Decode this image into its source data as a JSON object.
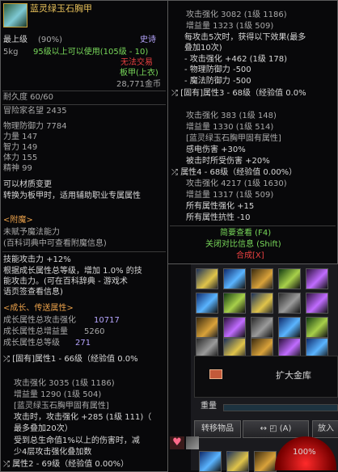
{
  "left": {
    "item_name": "蓝灵绿玉石胸甲",
    "grade": "最上级",
    "grade_pct": "(90%)",
    "rarity": "史诗",
    "weight": "5kg",
    "level_req": "95级以上可以使用(105级 - 10)",
    "trade": "无法交易",
    "slot_type": "板甲(上衣)",
    "price": "28,771金币",
    "durability": "耐久度 60/60",
    "reputation": "冒险家名望 2435",
    "stats": [
      "物理防御力 7784",
      "力量 147",
      "智力 149",
      "体力 155",
      "精神 99"
    ],
    "material_change": "可以材质变更",
    "material_desc": "转换为板甲时，适用辅助职业专属属性",
    "enchant_title": "<附魔>",
    "enchant_none": "未赋予魔法能力",
    "enchant_hint": "(百科词典中可查看附魔信息)",
    "skill_atk": "技能攻击力 +12%",
    "growth_desc": [
      "根据成长属性总等级，增加 1.0% 的技",
      "能攻击力。(可在百科辞典 - 游戏术",
      "语页签查看信息)"
    ],
    "growth_title": "<成长、传送属性>",
    "growth_atk_label": "成长属性总攻击强化",
    "growth_atk_val": "10717",
    "growth_amp_label": "成长属性总增益量",
    "growth_amp_val": "5260",
    "growth_lvl_label": "成长属性总等级",
    "growth_lvl_val": "271",
    "prop1_title": "[固有]属性1 - 66级（经验值 0.0%",
    "prop1_atk": "攻击强化 3035 (1级 1186)",
    "prop1_amp": "增益量 1290 (1级 504)",
    "prop1_fixed": "[蓝灵绿玉石胸甲固有属性]",
    "prop1_effect": [
      "攻击时，攻击强化 +285 (1级 111)（",
      "最多叠加20次）",
      "受到总生命值1%以上的伤害时，减",
      "少4层攻击强化叠加数"
    ],
    "prop2_title": "属性2 - 69级（经验值 0.00%）"
  },
  "right": {
    "lines": [
      "攻击强化 3082 (1级 1186)",
      "增益量 1323 (1级 509)",
      "每攻击5次时，获得以下效果(最多",
      "叠加10次)",
      "- 攻击强化 +462 (1级 178)",
      "- 物理防御力 -500",
      "- 魔法防御力 -500",
      "[固有]属性3 - 68级（经验值 0.0%",
      "攻击强化 383 (1级 148)",
      "增益量 1330 (1级 514)",
      "[蓝灵绿玉石胸甲固有属性]",
      "感电伤害 +30%",
      "被击时所受伤害 +20%",
      "属性4 - 68级（经验值 0.00%）",
      "攻击强化 4217 (1级 1630)",
      "增益量 1317 (1级 509)",
      "所有属性强化 +15",
      "所有属性抗性 -10"
    ],
    "brief": "简要查看 (F4)",
    "close_compare": "关闭对比信息 (Shift)",
    "craft": "合成[X]"
  },
  "inventory": {
    "bank_label": "扩大金库",
    "weight_label": "重量",
    "transfer_btn": "转移物品",
    "a_btn": "(A)",
    "put_btn": "放入",
    "hp_pct": "100%"
  },
  "colors": {
    "gold": "#e8c15a",
    "green": "#78d85a",
    "red": "#e84040",
    "purple": "#b7a6ff"
  }
}
